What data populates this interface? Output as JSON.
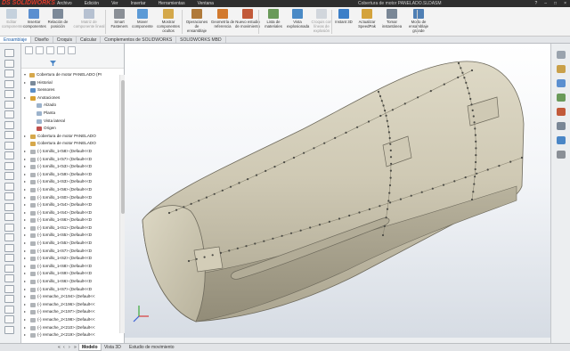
{
  "app": {
    "logo_text": "DS SOLIDWORKS",
    "menus": [
      "Archivo",
      "Edición",
      "Ver",
      "Insertar",
      "Herramientas",
      "Ventana"
    ],
    "doc_title": "Cobertura de motor PANELADO.SLDASM",
    "window_controls": [
      "?",
      "–",
      "□",
      "×"
    ]
  },
  "ribbon": [
    {
      "label": "Editar componente",
      "icon": "edit-component-icon",
      "color": "#8fa8c4",
      "enabled": false
    },
    {
      "label": "Insertar componentes",
      "icon": "insert-components-icon",
      "color": "#5b8fd0",
      "enabled": true
    },
    {
      "label": "Relación de posición",
      "icon": "mate-icon",
      "color": "#7d8a99",
      "enabled": true
    },
    {
      "label": "Matriz de componente lineal",
      "icon": "linear-pattern-icon",
      "color": "#6d86a8",
      "enabled": false
    },
    {
      "label": "Smart Fasteners",
      "icon": "fasteners-icon",
      "color": "#8a8f96",
      "enabled": true
    },
    {
      "label": "Mover componente",
      "icon": "move-component-icon",
      "color": "#5c9ad6",
      "enabled": true
    },
    {
      "label": "Mostrar componentes ocultos",
      "icon": "show-hidden-icon",
      "color": "#d4a84a",
      "enabled": true
    },
    {
      "label": "Operaciones de ensamblaje",
      "icon": "assembly-features-icon",
      "color": "#b07a3a",
      "enabled": true
    },
    {
      "label": "Geometría de referencia",
      "icon": "reference-geometry-icon",
      "color": "#d27a2e",
      "enabled": true
    },
    {
      "label": "Nuevo estudio de movimiento",
      "icon": "motion-study-icon",
      "color": "#c25a3a",
      "enabled": true
    },
    {
      "label": "Lista de materiales",
      "icon": "bom-icon",
      "color": "#6a9a5a",
      "enabled": true
    },
    {
      "label": "Vista explosionada",
      "icon": "exploded-view-icon",
      "color": "#4a8ac6",
      "enabled": true
    },
    {
      "label": "Croquis con líneas de explosión",
      "icon": "explode-line-icon",
      "color": "#a8b4c2",
      "enabled": false
    },
    {
      "label": "Instant 3D",
      "icon": "instant3d-icon",
      "color": "#3c7fc8",
      "enabled": true
    },
    {
      "label": "Actualizar SpeedPak",
      "icon": "speedpak-icon",
      "color": "#d4a33c",
      "enabled": true
    },
    {
      "label": "Tomar instantánea",
      "icon": "snapshot-icon",
      "color": "#7a8796",
      "enabled": true
    },
    {
      "label": "Modo de ensamblaje grande",
      "icon": "large-assembly-icon",
      "color": "#4f7fb4",
      "enabled": true
    }
  ],
  "tabs": [
    {
      "label": "Ensamblaje",
      "active": true
    },
    {
      "label": "Diseño",
      "active": false
    },
    {
      "label": "Croquis",
      "active": false
    },
    {
      "label": "Calcular",
      "active": false
    },
    {
      "label": "Complementos de SOLIDWORKS",
      "active": false
    },
    {
      "label": "SOLIDWORKS MBD",
      "active": false
    }
  ],
  "tree": {
    "root": "Cobertura de motor PANELADO (Pr",
    "items": [
      {
        "label": "Historial",
        "indent": 1,
        "expand": "▸",
        "icon": "history-icon",
        "color": "#7a8a9a"
      },
      {
        "label": "Sensores",
        "indent": 1,
        "expand": "",
        "icon": "sensor-icon",
        "color": "#5b8fc7"
      },
      {
        "label": "Anotaciones",
        "indent": 1,
        "expand": "▸",
        "icon": "annotation-icon",
        "color": "#d8a030"
      },
      {
        "label": "Alzado",
        "indent": 2,
        "expand": "",
        "icon": "plane-icon",
        "color": "#9cb3cc"
      },
      {
        "label": "Planta",
        "indent": 2,
        "expand": "",
        "icon": "plane-icon",
        "color": "#9cb3cc"
      },
      {
        "label": "Vista lateral",
        "indent": 2,
        "expand": "",
        "icon": "plane-icon",
        "color": "#9cb3cc"
      },
      {
        "label": "Origen",
        "indent": 2,
        "expand": "",
        "icon": "origin-icon",
        "color": "#c0504d"
      },
      {
        "label": "Cobertura de motor PANELADO",
        "indent": 1,
        "expand": "▸",
        "icon": "part-icon",
        "color": "#d6a84c"
      },
      {
        "label": "Cobertura de motor PANELADO",
        "indent": 1,
        "expand": "",
        "icon": "part-icon",
        "color": "#d6a84c"
      },
      {
        "label": "(-) tornillo_1<58> (Default<<D",
        "indent": 1,
        "expand": "▸",
        "icon": "screw-icon",
        "color": "#b0b4b8"
      },
      {
        "label": "(-) tornillo_1<57> (Default<<D",
        "indent": 1,
        "expand": "▸",
        "icon": "screw-icon",
        "color": "#b0b4b8"
      },
      {
        "label": "(-) tornillo_1<53> (Default<<D",
        "indent": 1,
        "expand": "▸",
        "icon": "screw-icon",
        "color": "#b0b4b8"
      },
      {
        "label": "(-) tornillo_1<59> (Default<<D",
        "indent": 1,
        "expand": "▸",
        "icon": "screw-icon",
        "color": "#b0b4b8"
      },
      {
        "label": "(-) tornillo_1<63> (Default<<D",
        "indent": 1,
        "expand": "▸",
        "icon": "screw-icon",
        "color": "#b0b4b8"
      },
      {
        "label": "(-) tornillo_1<56> (Default<<D",
        "indent": 1,
        "expand": "▸",
        "icon": "screw-icon",
        "color": "#b0b4b8"
      },
      {
        "label": "(-) tornillo_1<60> (Default<<D",
        "indent": 1,
        "expand": "▸",
        "icon": "screw-icon",
        "color": "#b0b4b8"
      },
      {
        "label": "(-) tornillo_1<54> (Default<<D",
        "indent": 1,
        "expand": "▸",
        "icon": "screw-icon",
        "color": "#b0b4b8"
      },
      {
        "label": "(-) tornillo_1<64> (Default<<D",
        "indent": 1,
        "expand": "▸",
        "icon": "screw-icon",
        "color": "#b0b4b8"
      },
      {
        "label": "(-) tornillo_1<66> (Default<<D",
        "indent": 1,
        "expand": "▸",
        "icon": "screw-icon",
        "color": "#b0b4b8"
      },
      {
        "label": "(-) tornillo_1<61> (Default<<D",
        "indent": 1,
        "expand": "▸",
        "icon": "screw-icon",
        "color": "#b0b4b8"
      },
      {
        "label": "(-) tornillo_1<65> (Default<<D",
        "indent": 1,
        "expand": "▸",
        "icon": "screw-icon",
        "color": "#b0b4b8"
      },
      {
        "label": "(-) tornillo_1<55> (Default<<D",
        "indent": 1,
        "expand": "▸",
        "icon": "screw-icon",
        "color": "#b0b4b8"
      },
      {
        "label": "(-) tornillo_1<67> (Default<<D",
        "indent": 1,
        "expand": "▸",
        "icon": "screw-icon",
        "color": "#b0b4b8"
      },
      {
        "label": "(-) tornillo_1<62> (Default<<D",
        "indent": 1,
        "expand": "▸",
        "icon": "screw-icon",
        "color": "#b0b4b8"
      },
      {
        "label": "(-) tornillo_1<68> (Default<<D",
        "indent": 1,
        "expand": "▸",
        "icon": "screw-icon",
        "color": "#b0b4b8"
      },
      {
        "label": "(-) tornillo_1<69> (Default<<D",
        "indent": 1,
        "expand": "▸",
        "icon": "screw-icon",
        "color": "#b0b4b8"
      },
      {
        "label": "(-) tornillo_1<66> (Default<<D",
        "indent": 1,
        "expand": "▸",
        "icon": "screw-icon",
        "color": "#b0b4b8"
      },
      {
        "label": "(-) tornillo_1<67> (Default<<D",
        "indent": 1,
        "expand": "▸",
        "icon": "screw-icon",
        "color": "#b0b4b8"
      },
      {
        "label": "(-) remache_2<194> (Default<<",
        "indent": 1,
        "expand": "▸",
        "icon": "rivet-icon",
        "color": "#b0b4b8"
      },
      {
        "label": "(-) remache_2<196> (Default<<",
        "indent": 1,
        "expand": "▸",
        "icon": "rivet-icon",
        "color": "#b0b4b8"
      },
      {
        "label": "(-) remache_2<197> (Default<<",
        "indent": 1,
        "expand": "▸",
        "icon": "rivet-icon",
        "color": "#b0b4b8"
      },
      {
        "label": "(-) remache_2<198> (Default<<",
        "indent": 1,
        "expand": "▸",
        "icon": "rivet-icon",
        "color": "#b0b4b8"
      },
      {
        "label": "(-) remache_2<210> (Default<<",
        "indent": 1,
        "expand": "▸",
        "icon": "rivet-icon",
        "color": "#b0b4b8"
      },
      {
        "label": "(-) remache_2<219> (Default<<",
        "indent": 1,
        "expand": "▸",
        "icon": "rivet-icon",
        "color": "#b0b4b8"
      }
    ]
  },
  "bottom_tabs": [
    {
      "label": "Modelo",
      "active": true
    },
    {
      "label": "Vista 3D",
      "active": false
    },
    {
      "label": "Estudio de movimiento",
      "active": false
    }
  ],
  "viewport": {
    "model_color": "#c8c2ad",
    "shade_color": "#9e9884",
    "triad_colors": [
      "#d63a3a",
      "#3aa93a",
      "#3a5fd6"
    ]
  }
}
